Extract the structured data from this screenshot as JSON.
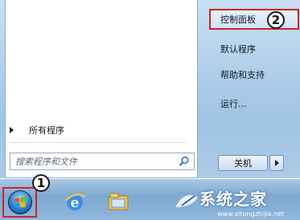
{
  "left_pane": {
    "all_programs_label": "所有程序",
    "search": {
      "placeholder": "搜索程序和文件",
      "value": ""
    }
  },
  "right_pane": {
    "items": [
      {
        "label": "控制面板",
        "highlighted": true
      },
      {
        "label": "默认程序"
      },
      {
        "label": "帮助和支持"
      },
      {
        "label": "运行..."
      }
    ],
    "shutdown_label": "关机"
  },
  "annotations": {
    "step1": "1",
    "step2": "2"
  },
  "watermark": {
    "text": "系统之家",
    "url": "www.xitongzhijia.net"
  },
  "colors": {
    "highlight_border": "#c8262a",
    "menu_bg": "#ffffff",
    "taskbar": "#8fb6db"
  },
  "icons": {
    "start": "windows-orb-icon",
    "taskbar_1": "internet-explorer-icon",
    "taskbar_2": "file-explorer-icon",
    "search": "search-icon"
  }
}
